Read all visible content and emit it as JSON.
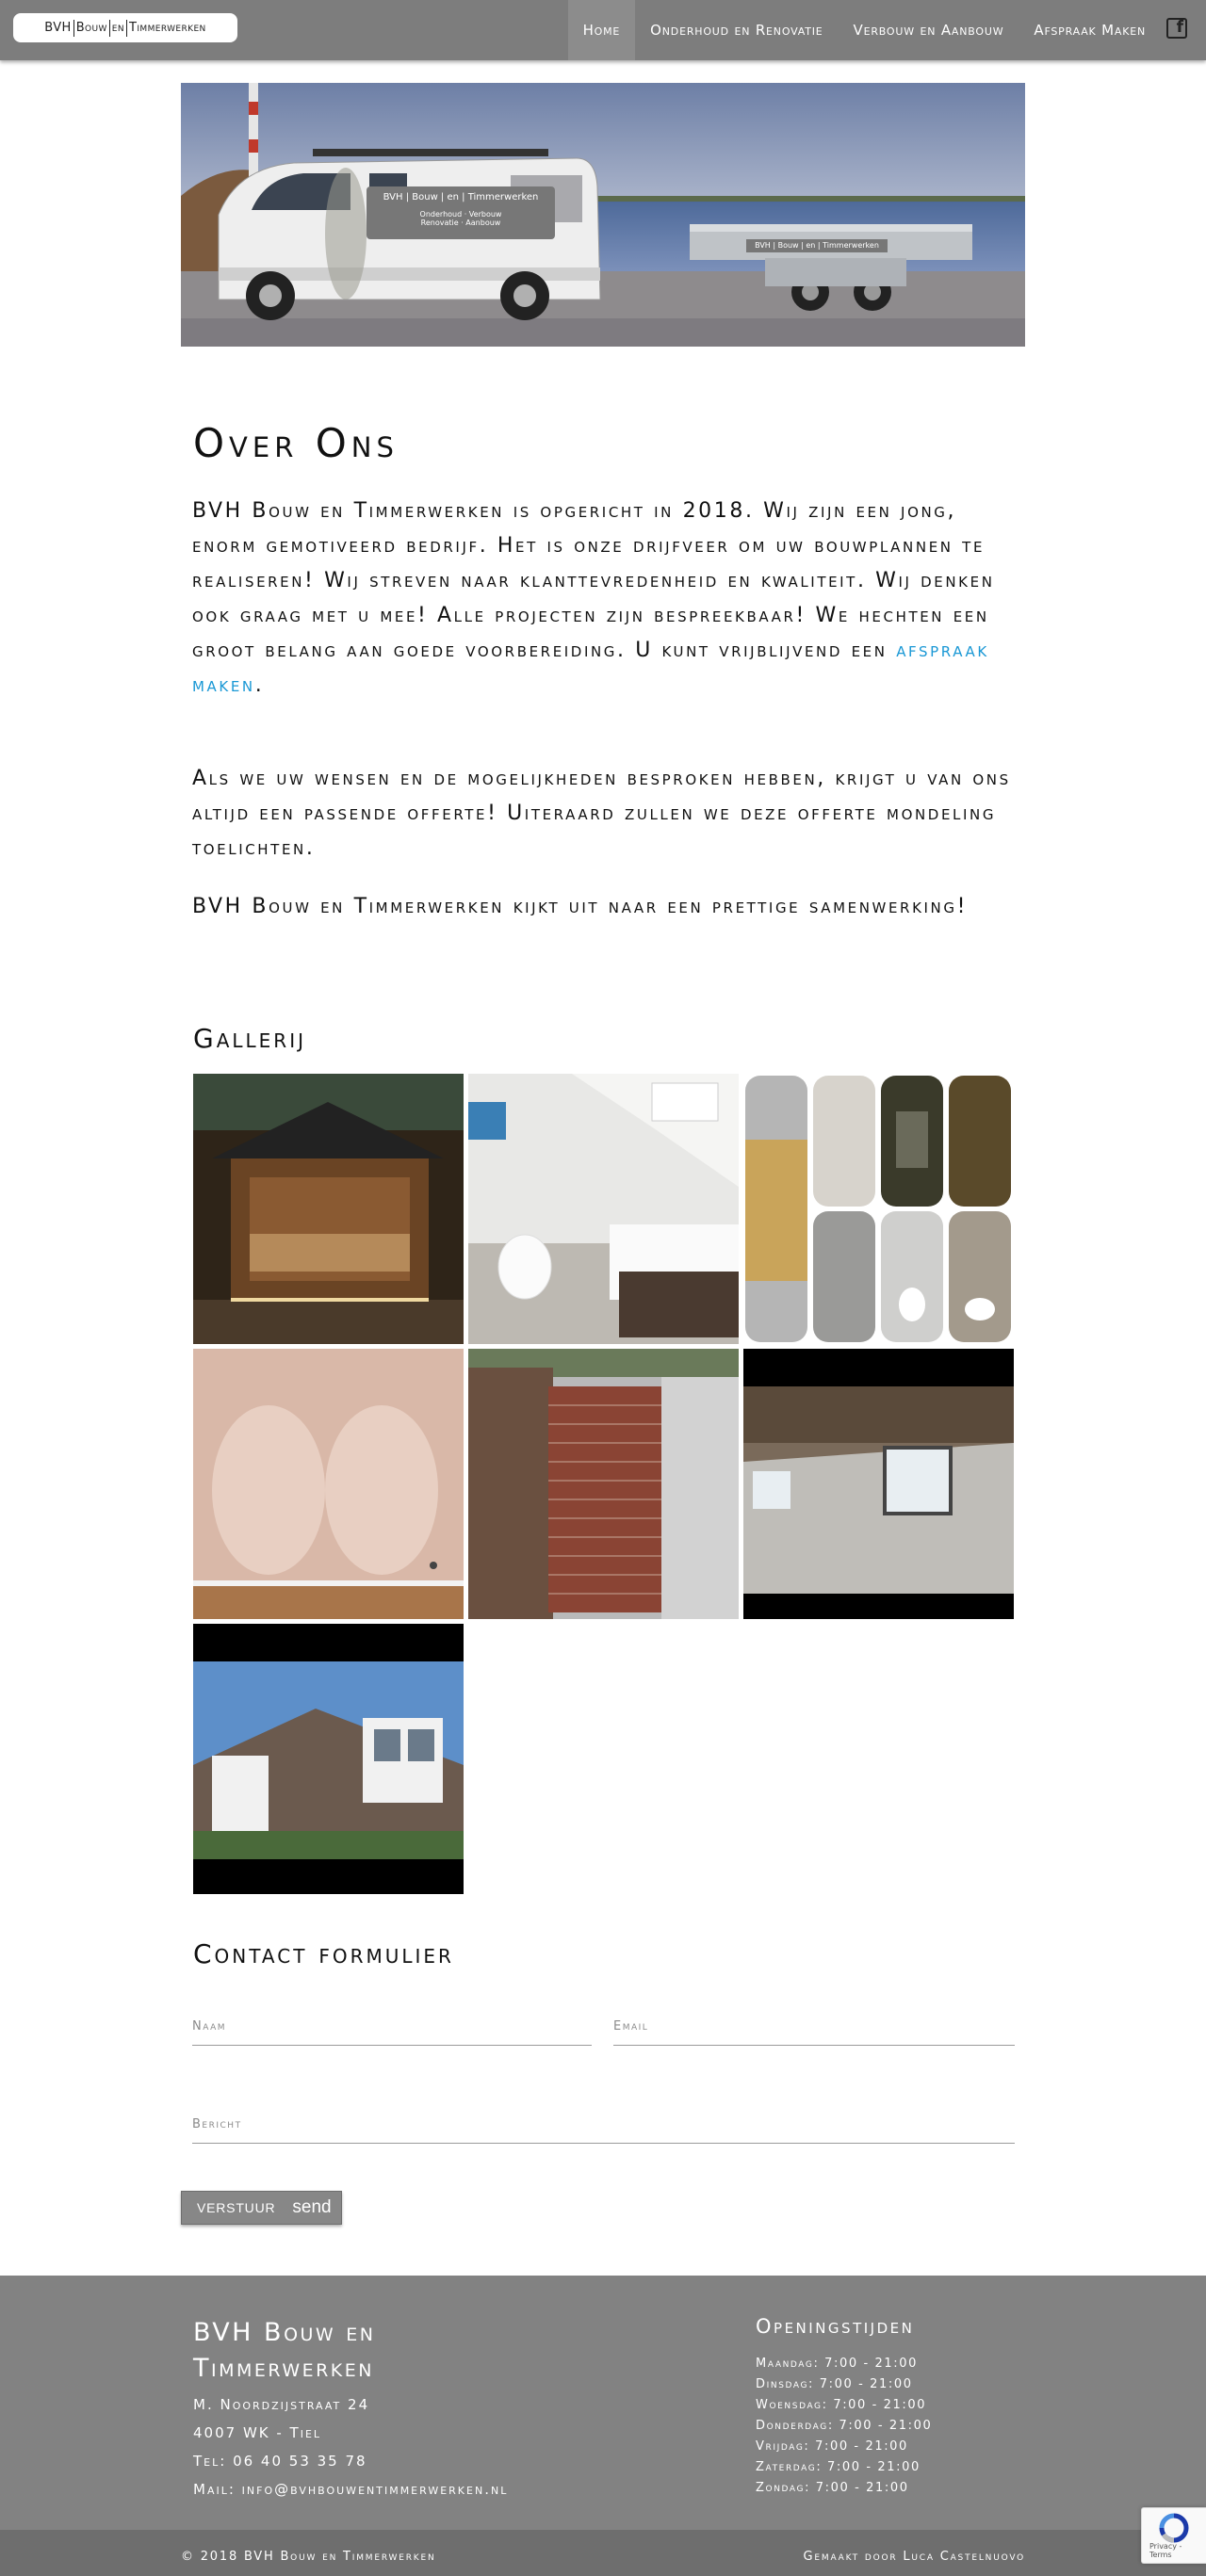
{
  "nav": {
    "logo": [
      "BVH",
      "Bouw",
      "en",
      "Timmerwerken"
    ],
    "items": [
      "Home",
      "Onderhoud en Renovatie",
      "Verbouw en Aanbouw",
      "Afspraak Maken"
    ],
    "social_icon": "facebook-icon"
  },
  "hero": {
    "van_logo": "BVH | Bouw | en | Timmerwerken",
    "van_sub1": "Onderhoud · Verbouw",
    "van_sub2": "Renovatie · Aanbouw",
    "trailer_logo": "BVH | Bouw | en | Timmerwerken"
  },
  "about": {
    "title": "Over Ons",
    "p1_pre": "BVH Bouw en Timmerwerken is opgericht in 2018. Wij zijn een jong, enorm gemotiveerd bedrijf. Het is onze drijfveer om uw bouwplannen te realiseren! Wij streven naar klanttevredenheid en kwaliteit. Wij denken ook graag met u mee! Alle projecten zijn bespreekbaar! We hechten een groot belang aan goede voorbereiding. U kunt vrijblijvend een ",
    "p1_link": "afspraak maken",
    "p1_post": ".",
    "p2": "Als we uw wensen en de mogelijkheden besproken hebben, krijgt u van ons altijd een passende offerte! Uiteraard zullen we deze offerte mondeling toelichten.",
    "p3": "BVH Bouw en Timmerwerken kijkt uit naar een prettige samenwerking!"
  },
  "gallery": {
    "title": "Gallerij"
  },
  "contact": {
    "title": "Contact formulier",
    "name_placeholder": "Naam",
    "email_placeholder": "Email",
    "message_placeholder": "Bericht",
    "submit_label": "VERSTUUR",
    "submit_icon_label": "send"
  },
  "footer": {
    "company": "BVH Bouw en Timmerwerken",
    "address": "M. Noordzijstraat 24",
    "postal": "4007 WK - Tiel",
    "phone": "Tel: 06 40 53 35 78",
    "mail": "Mail: info@bvhbouwentimmerwerken.nl",
    "hours_title": "Openingstijden",
    "hours": [
      "Maandag: 7:00 - 21:00",
      "Dinsdag: 7:00 - 21:00",
      "Woensdag: 7:00 - 21:00",
      "Donderdag: 7:00 - 21:00",
      "Vrijdag: 7:00 - 21:00",
      "Zaterdag: 7:00 - 21:00",
      "Zondag: 7:00 - 21:00"
    ],
    "copyright": "© 2018 BVH Bouw en Timmerwerken",
    "made_by": "Gemaakt door Luca Castelnuovo",
    "recaptcha": "Privacy - Terms"
  }
}
